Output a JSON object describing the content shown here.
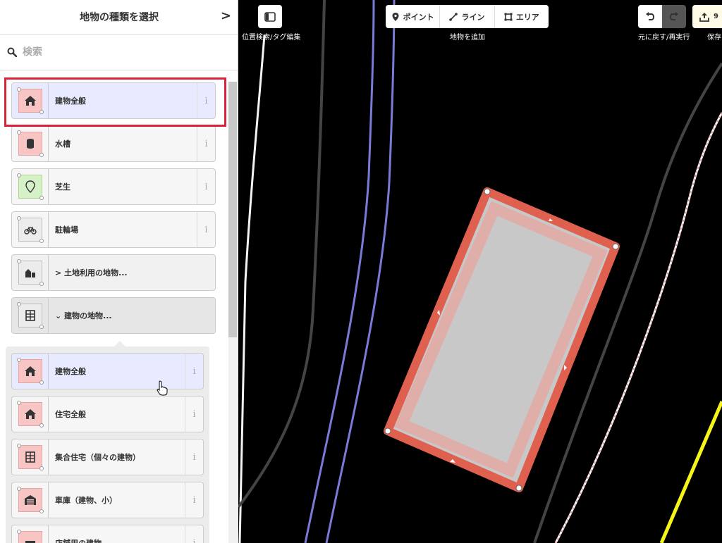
{
  "sidebar": {
    "title": "地物の種類を選択",
    "search_placeholder": "検索",
    "presets": [
      {
        "label": "建物全般",
        "info": "i"
      },
      {
        "label": "水槽",
        "info": "i"
      },
      {
        "label": "芝生",
        "info": "i"
      },
      {
        "label": "駐輪場",
        "info": "i"
      },
      {
        "label": "> 土地利用の地物..."
      },
      {
        "label": "⌄ 建物の地物..."
      }
    ],
    "building_presets": [
      {
        "label": "建物全般",
        "info": "i"
      },
      {
        "label": "住宅全般",
        "info": "i"
      },
      {
        "label": "集合住宅（個々の建物）",
        "info": "i"
      },
      {
        "label": "車庫（建物、小）",
        "info": "i"
      },
      {
        "label": "店舗用の建物",
        "info": "i"
      }
    ]
  },
  "toolbar": {
    "sidebar_toggle_caption": "位置検索/タグ編集",
    "modes": [
      "ポイント",
      "ライン",
      "エリア"
    ],
    "add_feature_caption": "地物を追加",
    "undo_redo_caption": "元に戻す/再実行",
    "save_badge": "9",
    "save_caption": "保存"
  },
  "colors": {
    "accent_highlight": "#d9233a",
    "selected_area": "#e06050",
    "road_blue": "#7a7ad8",
    "road_yellow": "#f5f518"
  }
}
